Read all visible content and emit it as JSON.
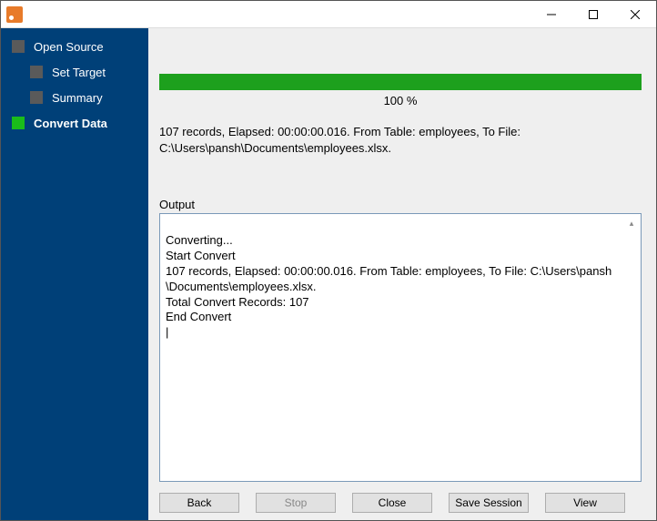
{
  "sidebar": {
    "items": [
      {
        "label": "Open Source",
        "level": 0,
        "active": false
      },
      {
        "label": "Set Target",
        "level": 1,
        "active": false
      },
      {
        "label": "Summary",
        "level": 1,
        "active": false
      },
      {
        "label": "Convert Data",
        "level": 0,
        "active": true
      }
    ]
  },
  "progress": {
    "percent_label": "100 %"
  },
  "status": "107 records,    Elapsed: 00:00:00.016.    From Table: employees,    To File:\nC:\\Users\\pansh\\Documents\\employees.xlsx.",
  "output": {
    "label": "Output",
    "text": "Converting...\nStart Convert\n107 records,    Elapsed: 00:00:00.016.    From Table: employees,    To File: C:\\Users\\pansh\n\\Documents\\employees.xlsx.\nTotal Convert Records: 107\nEnd Convert\n|"
  },
  "buttons": {
    "back": "Back",
    "stop": "Stop",
    "close": "Close",
    "save_session": "Save Session",
    "view": "View"
  }
}
